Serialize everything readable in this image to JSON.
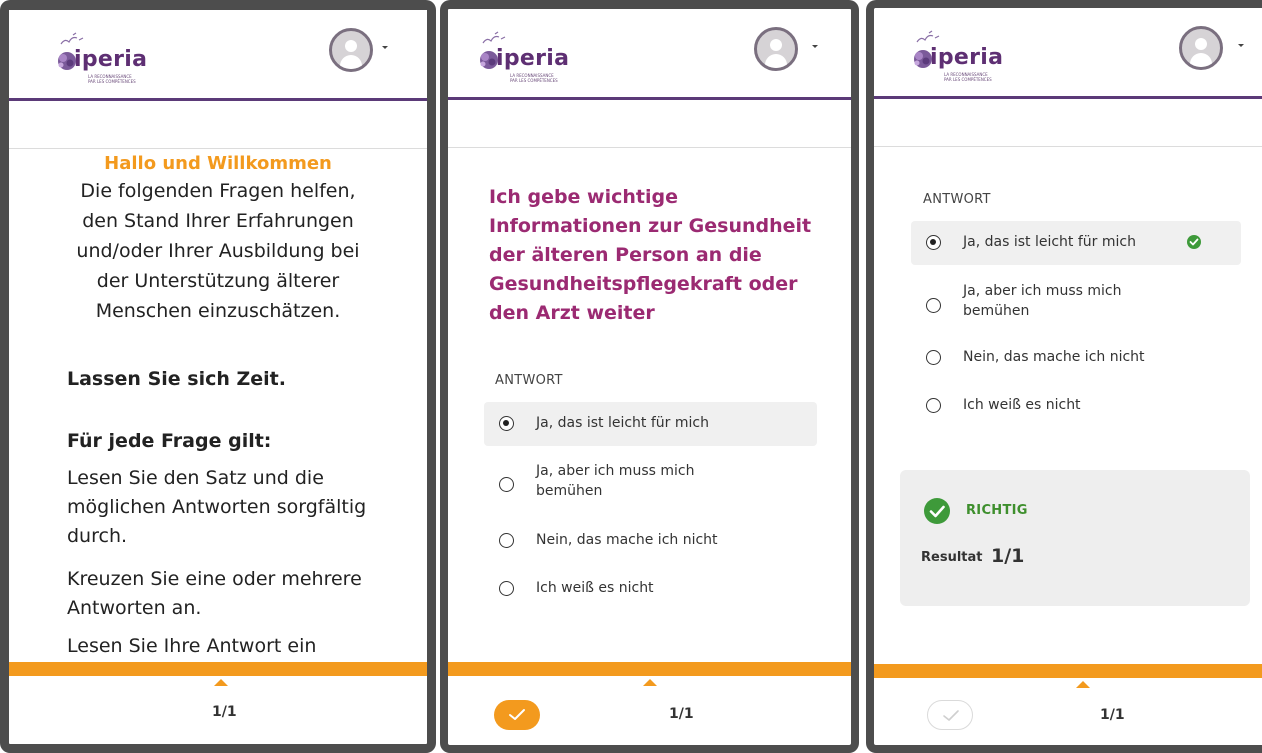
{
  "brand": {
    "name": "iperia",
    "tagline_1": "LA RECONNAISSANCE",
    "tagline_2": "PAR LES COMPÉTENCES"
  },
  "colors": {
    "header_line": "#5b3a78",
    "accent_orange": "#f39a1e",
    "question_magenta": "#9b2a72",
    "success_green": "#3e9a3a"
  },
  "screens": [
    {
      "welcome_title": "Hallo und Willkommen",
      "welcome_lines": [
        "Die folgenden Fragen helfen,",
        "den Stand Ihrer Erfahrungen",
        "und/oder Ihrer Ausbildung bei",
        "der Unterstützung älterer",
        "Menschen einzuschätzen."
      ],
      "take_time": "Lassen Sie sich Zeit.",
      "for_each": "Für jede Frage gilt:",
      "paragraphs": [
        "Lesen Sie den Satz und die möglichen Antworten sorgfältig durch.",
        "Kreuzen Sie eine oder mehrere Antworten an.",
        "Lesen Sie Ihre Antwort ein"
      ],
      "pager": "1/1"
    },
    {
      "question": "Ich gebe wichtige Informationen zur Gesundheit der älteren Person an die Gesundheitspflegekraft oder den Arzt weiter",
      "answer_label": "ANTWORT",
      "options": [
        {
          "line1": "Ja, das ist leicht für mich",
          "line2": "",
          "selected": true
        },
        {
          "line1": "Ja, aber ich muss mich",
          "line2": "bemühen",
          "selected": false
        },
        {
          "line1": "Nein, das mache ich nicht",
          "line2": "",
          "selected": false
        },
        {
          "line1": "Ich weiß es nicht",
          "line2": "",
          "selected": false
        }
      ],
      "validate_icon": "check-icon",
      "pager": "1/1"
    },
    {
      "answer_label": "ANTWORT",
      "options": [
        {
          "line1": "Ja, das ist leicht für mich",
          "line2": "",
          "selected": true,
          "correct": true
        },
        {
          "line1": "Ja, aber ich muss mich",
          "line2": "bemühen",
          "selected": false
        },
        {
          "line1": "Nein, das mache ich nicht",
          "line2": "",
          "selected": false
        },
        {
          "line1": "Ich weiß es nicht",
          "line2": "",
          "selected": false
        }
      ],
      "result_status": "RICHTIG",
      "result_label": "Resultat",
      "result_value": "1/1",
      "pager": "1/1"
    }
  ]
}
